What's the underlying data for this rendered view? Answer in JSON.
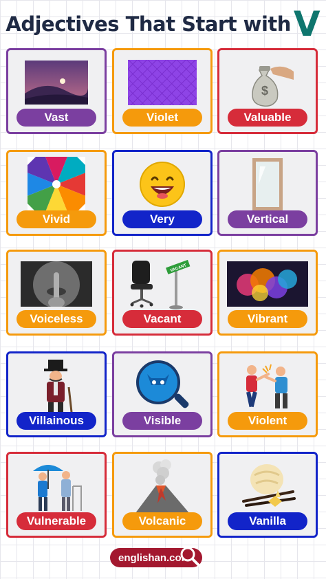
{
  "title": {
    "text": "Adjectives That Start with",
    "letter": "V"
  },
  "colors": {
    "purple": "#7b3fa0",
    "orange": "#f59a0c",
    "red": "#d62c3a",
    "blue": "#1224c9",
    "title_dark": "#1f2a44",
    "title_teal": "#0f766e"
  },
  "cards": [
    {
      "word": "Vast",
      "color": "#7b3fa0",
      "icon": "landscape-picture"
    },
    {
      "word": "Violet",
      "color": "#f59a0c",
      "icon": "violet-pattern-picture"
    },
    {
      "word": "Valuable",
      "color": "#d62c3a",
      "icon": "money-bag-picture"
    },
    {
      "word": "Vivid",
      "color": "#f59a0c",
      "icon": "rainbow-swirl-picture"
    },
    {
      "word": "Very",
      "color": "#1224c9",
      "icon": "laughing-emoji-picture"
    },
    {
      "word": "Vertical",
      "color": "#7b3fa0",
      "icon": "mirror-picture"
    },
    {
      "word": "Voiceless",
      "color": "#f59a0c",
      "icon": "finger-on-lips-picture"
    },
    {
      "word": "Vacant",
      "color": "#d62c3a",
      "icon": "empty-chair-picture"
    },
    {
      "word": "Vibrant",
      "color": "#f59a0c",
      "icon": "color-smoke-picture"
    },
    {
      "word": "Villainous",
      "color": "#1224c9",
      "icon": "villain-picture"
    },
    {
      "word": "Visible",
      "color": "#7b3fa0",
      "icon": "magnifier-cat-picture"
    },
    {
      "word": "Violent",
      "color": "#f59a0c",
      "icon": "fighting-men-picture"
    },
    {
      "word": "Vulnerable",
      "color": "#d62c3a",
      "icon": "elderly-people-picture"
    },
    {
      "word": "Volcanic",
      "color": "#f59a0c",
      "icon": "volcano-picture"
    },
    {
      "word": "Vanilla",
      "color": "#1224c9",
      "icon": "vanilla-ice-cream-picture"
    }
  ],
  "footer": {
    "site": "englishan.com",
    "icon": "search-icon"
  }
}
